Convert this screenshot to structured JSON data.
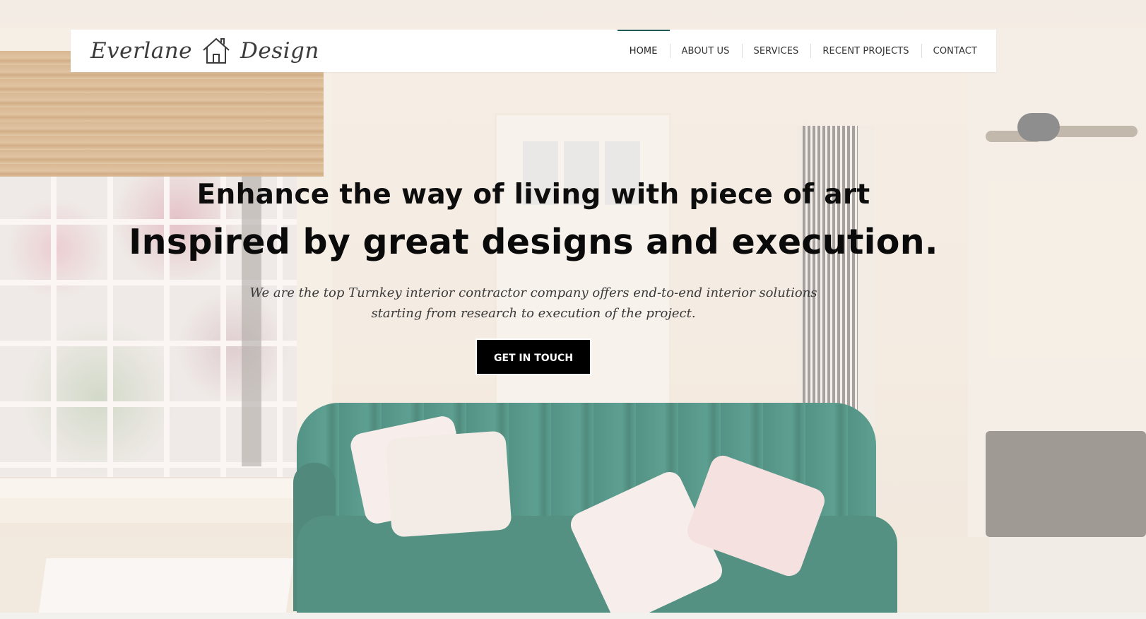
{
  "brand": {
    "name_left": "Everlane",
    "name_right": "Design",
    "icon": "house-outline-icon"
  },
  "nav": {
    "items": [
      {
        "label": "HOME",
        "active": true
      },
      {
        "label": "ABOUT US",
        "active": false
      },
      {
        "label": "SERVICES",
        "active": false
      },
      {
        "label": "RECENT PROJECTS",
        "active": false
      },
      {
        "label": "CONTACT",
        "active": false
      }
    ],
    "active_indicator_color": "#1f5e58"
  },
  "hero": {
    "headline_1": "Enhance the way of living with piece of art",
    "headline_2": "Inspired by great designs and execution.",
    "subtitle_line_1": "We are the top Turnkey interior contractor company offers end-to-end interior solutions",
    "subtitle_line_2": "starting from research to execution of the project.",
    "cta_label": "GET IN TOUCH",
    "cta_color": "#000000"
  }
}
